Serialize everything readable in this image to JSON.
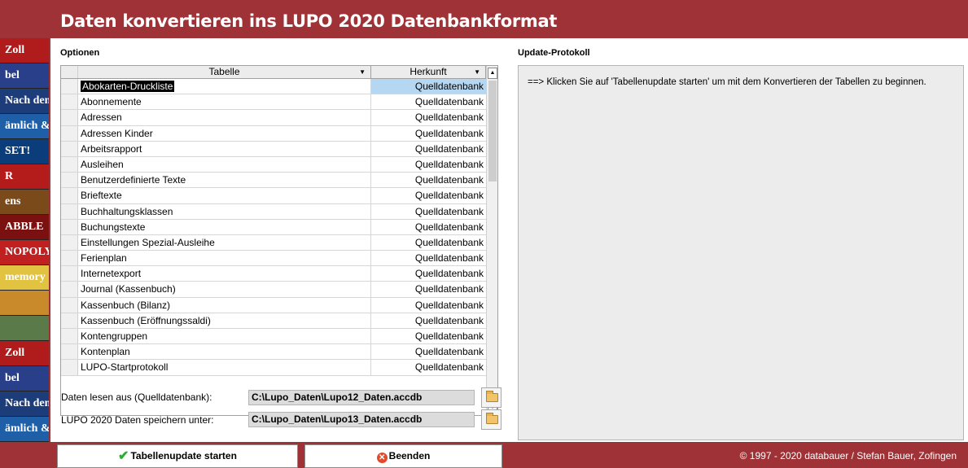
{
  "window": {
    "title": "Daten konvertieren ins LUPO 2020 Datenbankformat"
  },
  "options": {
    "label": "Optionen",
    "columns": {
      "tabelle": "Tabelle",
      "herkunft": "Herkunft"
    },
    "rows": [
      {
        "tabelle": "Abokarten-Druckliste",
        "herkunft": "Quelldatenbank"
      },
      {
        "tabelle": "Abonnemente",
        "herkunft": "Quelldatenbank"
      },
      {
        "tabelle": "Adressen",
        "herkunft": "Quelldatenbank"
      },
      {
        "tabelle": "Adressen Kinder",
        "herkunft": "Quelldatenbank"
      },
      {
        "tabelle": "Arbeitsrapport",
        "herkunft": "Quelldatenbank"
      },
      {
        "tabelle": "Ausleihen",
        "herkunft": "Quelldatenbank"
      },
      {
        "tabelle": "Benutzerdefinierte Texte",
        "herkunft": "Quelldatenbank"
      },
      {
        "tabelle": "Brieftexte",
        "herkunft": "Quelldatenbank"
      },
      {
        "tabelle": "Buchhaltungsklassen",
        "herkunft": "Quelldatenbank"
      },
      {
        "tabelle": "Buchungstexte",
        "herkunft": "Quelldatenbank"
      },
      {
        "tabelle": "Einstellungen Spezial-Ausleihe",
        "herkunft": "Quelldatenbank"
      },
      {
        "tabelle": "Ferienplan",
        "herkunft": "Quelldatenbank"
      },
      {
        "tabelle": "Internetexport",
        "herkunft": "Quelldatenbank"
      },
      {
        "tabelle": "Journal (Kassenbuch)",
        "herkunft": "Quelldatenbank"
      },
      {
        "tabelle": "Kassenbuch (Bilanz)",
        "herkunft": "Quelldatenbank"
      },
      {
        "tabelle": "Kassenbuch (Eröffnungssaldi)",
        "herkunft": "Quelldatenbank"
      },
      {
        "tabelle": "Kontengruppen",
        "herkunft": "Quelldatenbank"
      },
      {
        "tabelle": "Kontenplan",
        "herkunft": "Quelldatenbank"
      },
      {
        "tabelle": "LUPO-Startprotokoll",
        "herkunft": "Quelldatenbank"
      }
    ]
  },
  "source": {
    "label": "Daten lesen aus (Quelldatenbank):",
    "path": "C:\\Lupo_Daten\\Lupo12_Daten.accdb"
  },
  "target": {
    "label": "LUPO 2020 Daten speichern unter:",
    "path": "C:\\Lupo_Daten\\Lupo13_Daten.accdb"
  },
  "protocol": {
    "label": "Update-Protokoll",
    "message": "==>  Klicken Sie auf 'Tabellenupdate starten' um mit dem Konvertieren der Tabellen zu beginnen."
  },
  "footer": {
    "start_label": "Tabellenupdate starten",
    "close_label": "Beenden",
    "copyright": "© 1997 - 2020 databauer / Stefan Bauer, Zofingen"
  },
  "side_tiles": [
    {
      "text": "Zoll",
      "color": "#b01c1c"
    },
    {
      "text": "bel",
      "color": "#2a3f8a"
    },
    {
      "text": "Nach dem Regen",
      "color": "#1d3c7a"
    },
    {
      "text": "ämlich & Co.",
      "color": "#1f5fa8"
    },
    {
      "text": "SET!",
      "color": "#0b3d7a"
    },
    {
      "text": "R",
      "color": "#b41c1c"
    },
    {
      "text": "ens",
      "color": "#7a4a1a"
    },
    {
      "text": "ABBLE",
      "color": "#7a1010"
    },
    {
      "text": "NOPOLY",
      "color": "#c02020"
    },
    {
      "text": "memory",
      "color": "#e1c341"
    },
    {
      "text": "",
      "color": "#c88a2a"
    },
    {
      "text": "",
      "color": "#5a7a4a"
    },
    {
      "text": "Zoll",
      "color": "#b01c1c"
    },
    {
      "text": "bel",
      "color": "#2a3f8a"
    },
    {
      "text": "Nach dem Regen",
      "color": "#1d3c7a"
    },
    {
      "text": "ämlich & Co.",
      "color": "#1f5fa8"
    }
  ],
  "colors": {
    "frame": "#9e3236",
    "selection": "#b6d7f2",
    "protocol_bg": "#ececec"
  }
}
